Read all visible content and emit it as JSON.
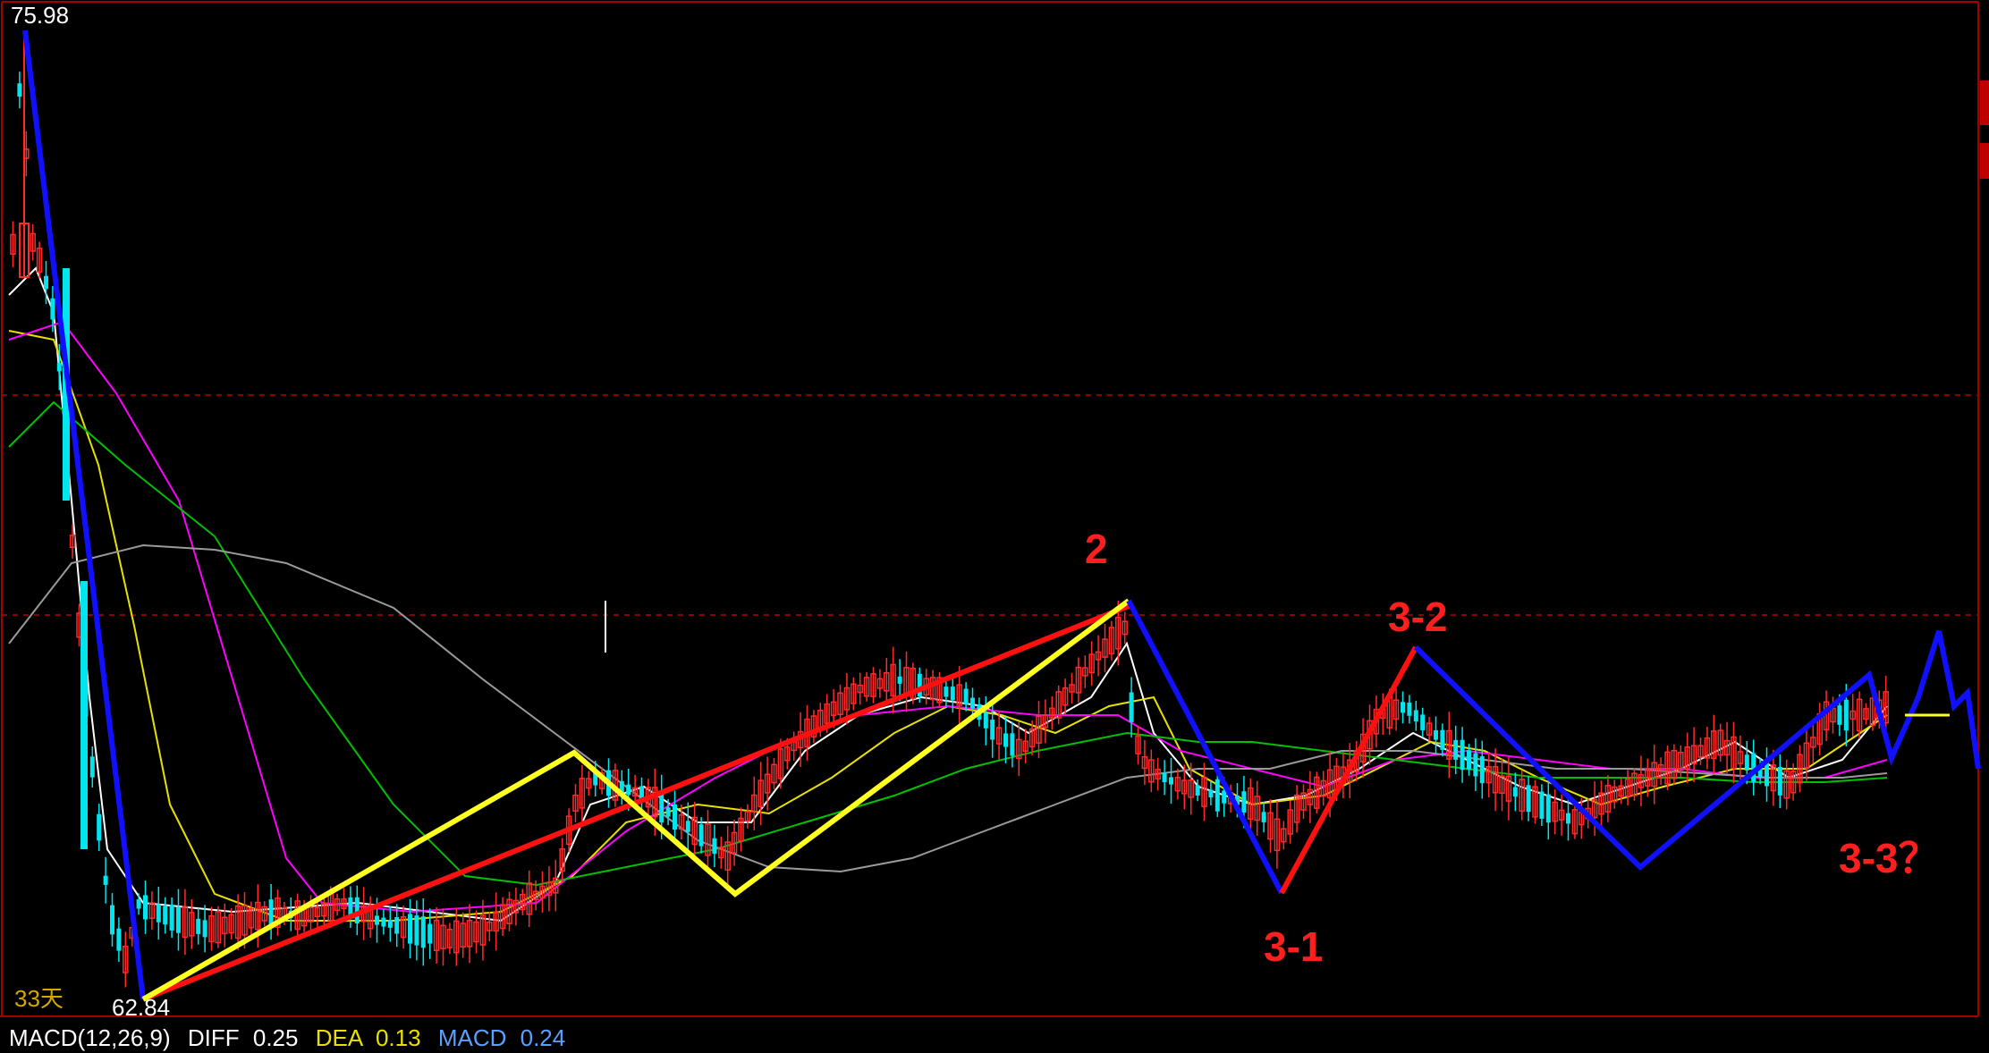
{
  "chart_data": {
    "type": "candlestick",
    "price_high_label": "75.98",
    "price_low_label": "62.84",
    "days_label": "33天",
    "wave_labels": [
      "2",
      "3-1",
      "3-2",
      "3-3？"
    ],
    "macd": {
      "name": "MACD(12,26,9)",
      "diff_label": "DIFF",
      "diff_value": "0.25",
      "dea_label": "DEA",
      "dea_value": "0.13",
      "macd_label": "MACD",
      "macd_value": "0.24"
    },
    "colors": {
      "background": "#000000",
      "grid": "#8b0000",
      "up_candle": "#ff2b2b",
      "down_candle": "#00e5ee",
      "wave_blue": "#1010ff",
      "wave_red": "#ff1010",
      "wave_yellow": "#ffff20",
      "ma_white": "#ffffff",
      "ma_yellow": "#e8e000",
      "ma_magenta": "#ff00ff",
      "ma_green": "#00c000",
      "ma_gray": "#9a9a9a"
    }
  }
}
